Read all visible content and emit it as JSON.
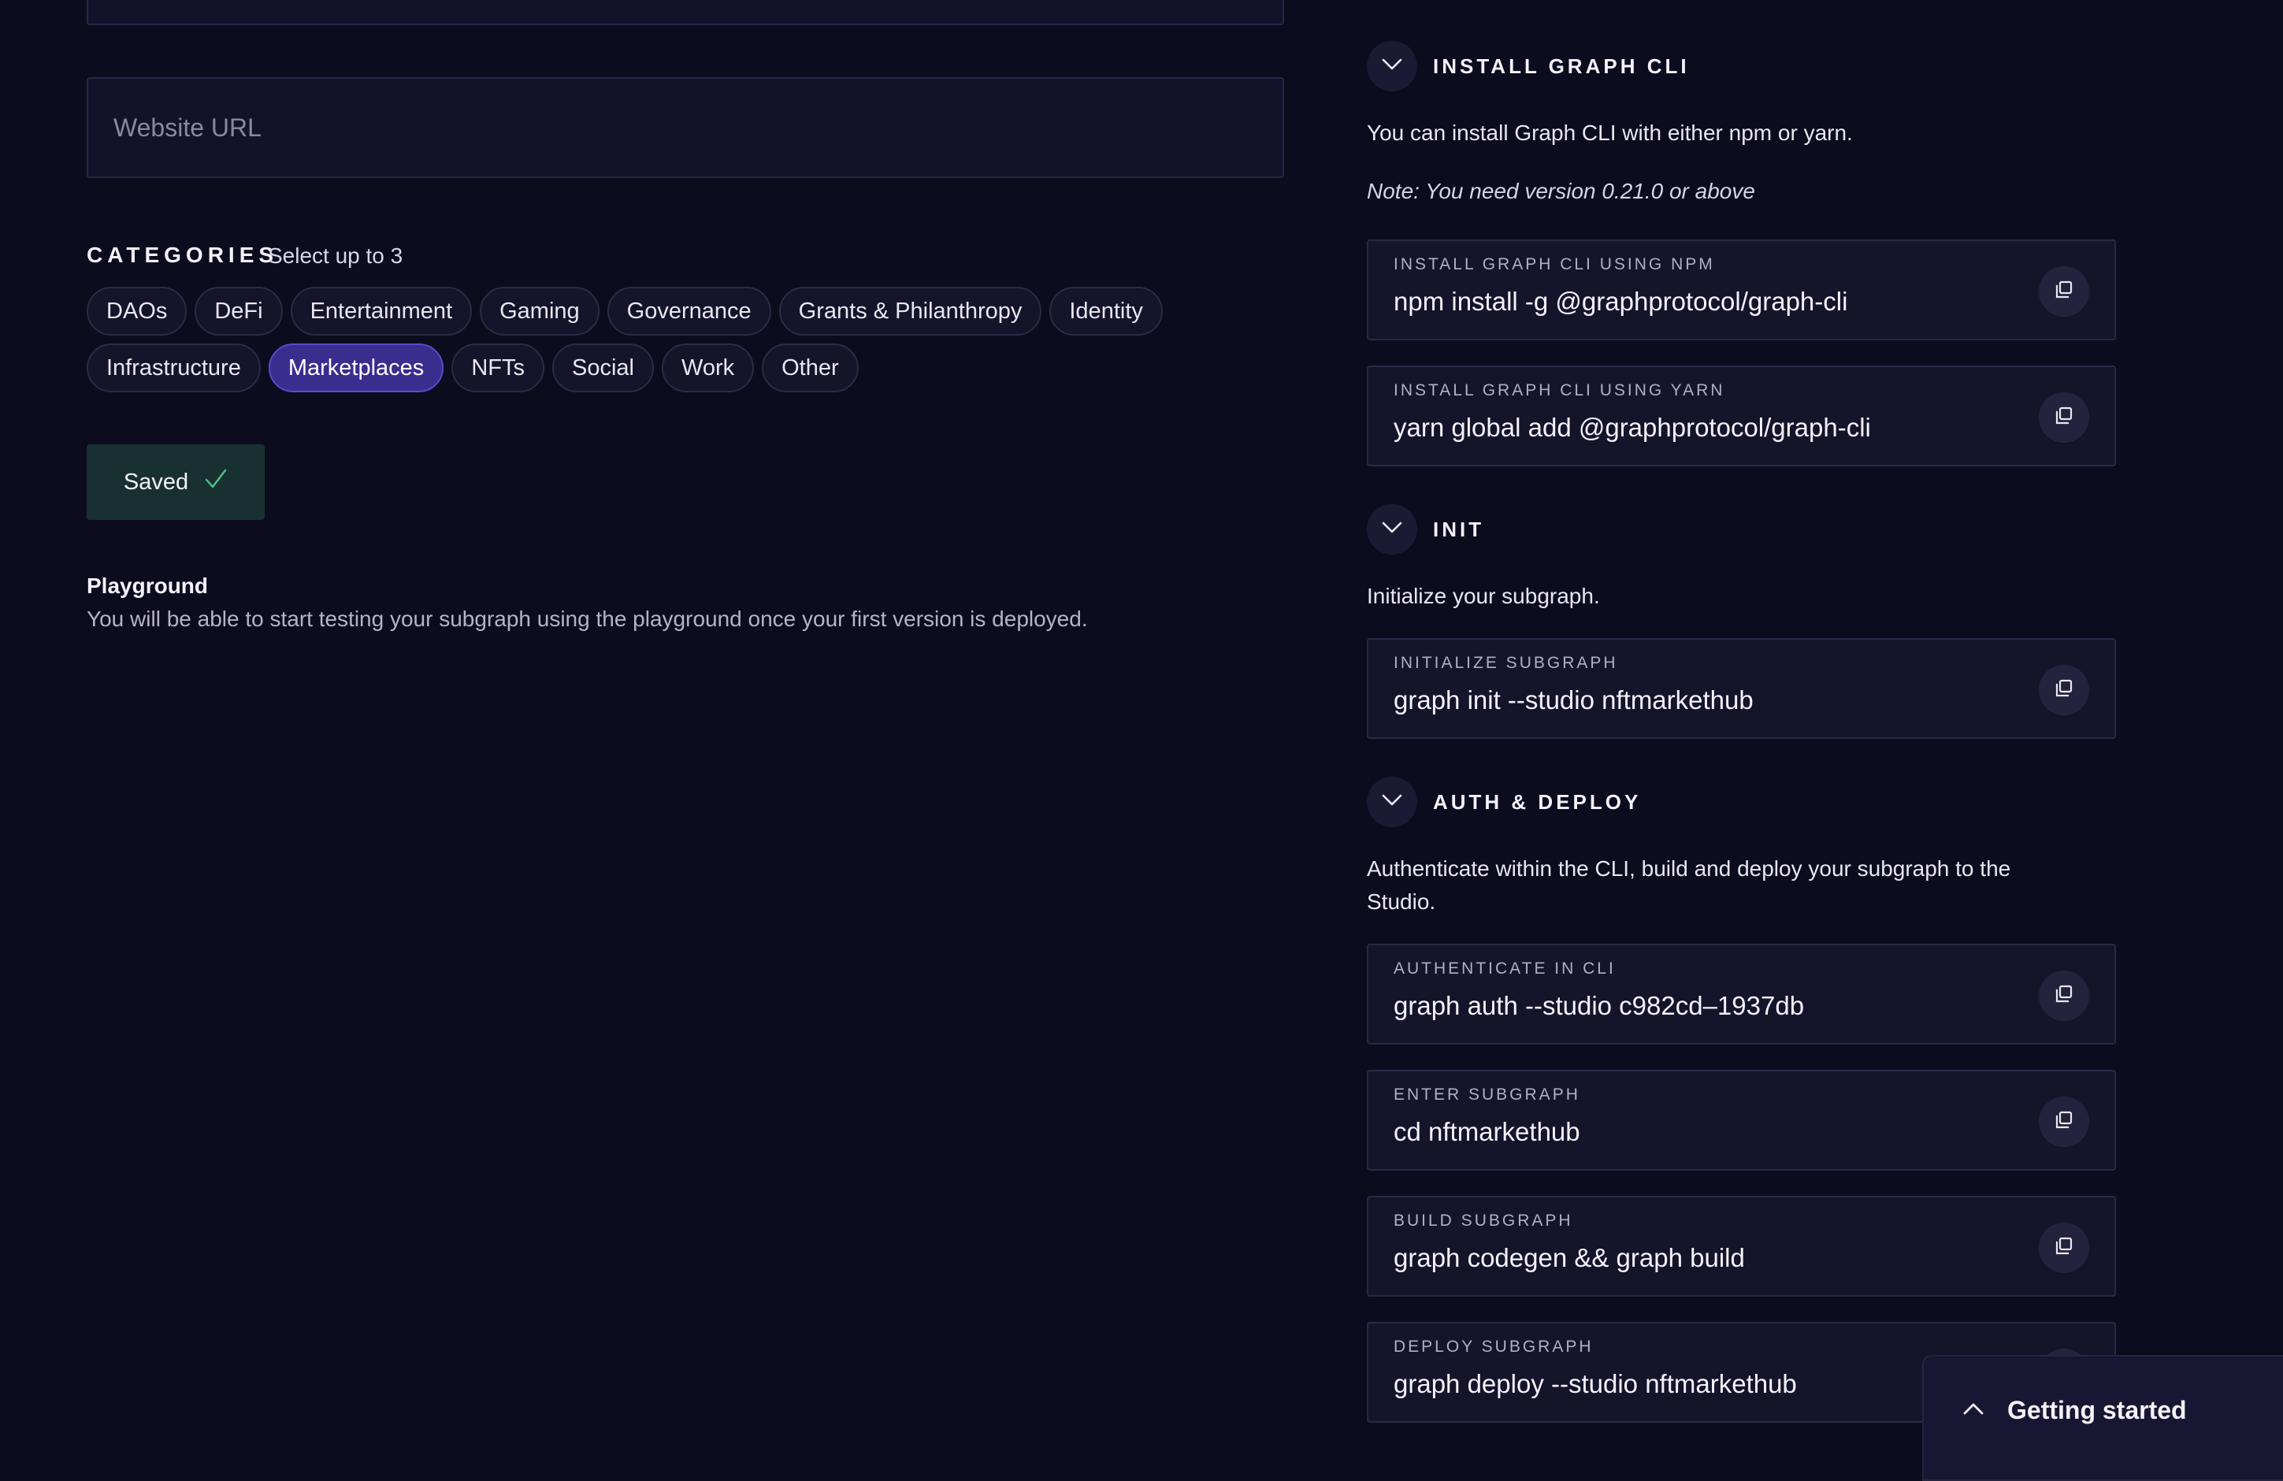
{
  "form": {
    "website_placeholder": "Website URL",
    "categories_title": "CATEGORIES",
    "categories_hint": "Select up to 3",
    "categories": [
      {
        "label": "DAOs",
        "selected": false
      },
      {
        "label": "DeFi",
        "selected": false
      },
      {
        "label": "Entertainment",
        "selected": false
      },
      {
        "label": "Gaming",
        "selected": false
      },
      {
        "label": "Governance",
        "selected": false
      },
      {
        "label": "Grants & Philanthropy",
        "selected": false
      },
      {
        "label": "Identity",
        "selected": false
      },
      {
        "label": "Infrastructure",
        "selected": false
      },
      {
        "label": "Marketplaces",
        "selected": true
      },
      {
        "label": "NFTs",
        "selected": false
      },
      {
        "label": "Social",
        "selected": false
      },
      {
        "label": "Work",
        "selected": false
      },
      {
        "label": "Other",
        "selected": false
      }
    ],
    "saved_label": "Saved",
    "saved_icon": "check-icon"
  },
  "playground": {
    "title": "Playground",
    "description": "You will be able to start testing your subgraph using the playground once your first version is deployed."
  },
  "sections": {
    "install": {
      "title": "INSTALL GRAPH CLI",
      "text": "You can install Graph CLI with either npm or yarn.",
      "note": "Note: You need version 0.21.0 or above",
      "commands": [
        {
          "label": "INSTALL GRAPH CLI USING NPM",
          "value": "npm install -g @graphprotocol/graph-cli"
        },
        {
          "label": "INSTALL GRAPH CLI USING YARN",
          "value": "yarn global add @graphprotocol/graph-cli"
        }
      ]
    },
    "init": {
      "title": "INIT",
      "text": "Initialize your subgraph.",
      "commands": [
        {
          "label": "INITIALIZE SUBGRAPH",
          "value": "graph init --studio nftmarkethub"
        }
      ]
    },
    "auth": {
      "title": "AUTH & DEPLOY",
      "text": "Authenticate within the CLI, build and deploy your subgraph to the Studio.",
      "commands": [
        {
          "label": "AUTHENTICATE IN CLI",
          "value": "graph auth --studio c982cd–1937db"
        },
        {
          "label": "ENTER SUBGRAPH",
          "value": "cd nftmarkethub"
        },
        {
          "label": "BUILD SUBGRAPH",
          "value": "graph codegen && graph build"
        },
        {
          "label": "DEPLOY SUBGRAPH",
          "value": "graph deploy --studio nftmarkethub"
        }
      ]
    }
  },
  "getting_started": {
    "label": "Getting started"
  },
  "colors": {
    "background": "#0d0b1e",
    "selected_chip": "#3a2d8e",
    "saved_button": "#183130",
    "check": "#4cc38a"
  }
}
